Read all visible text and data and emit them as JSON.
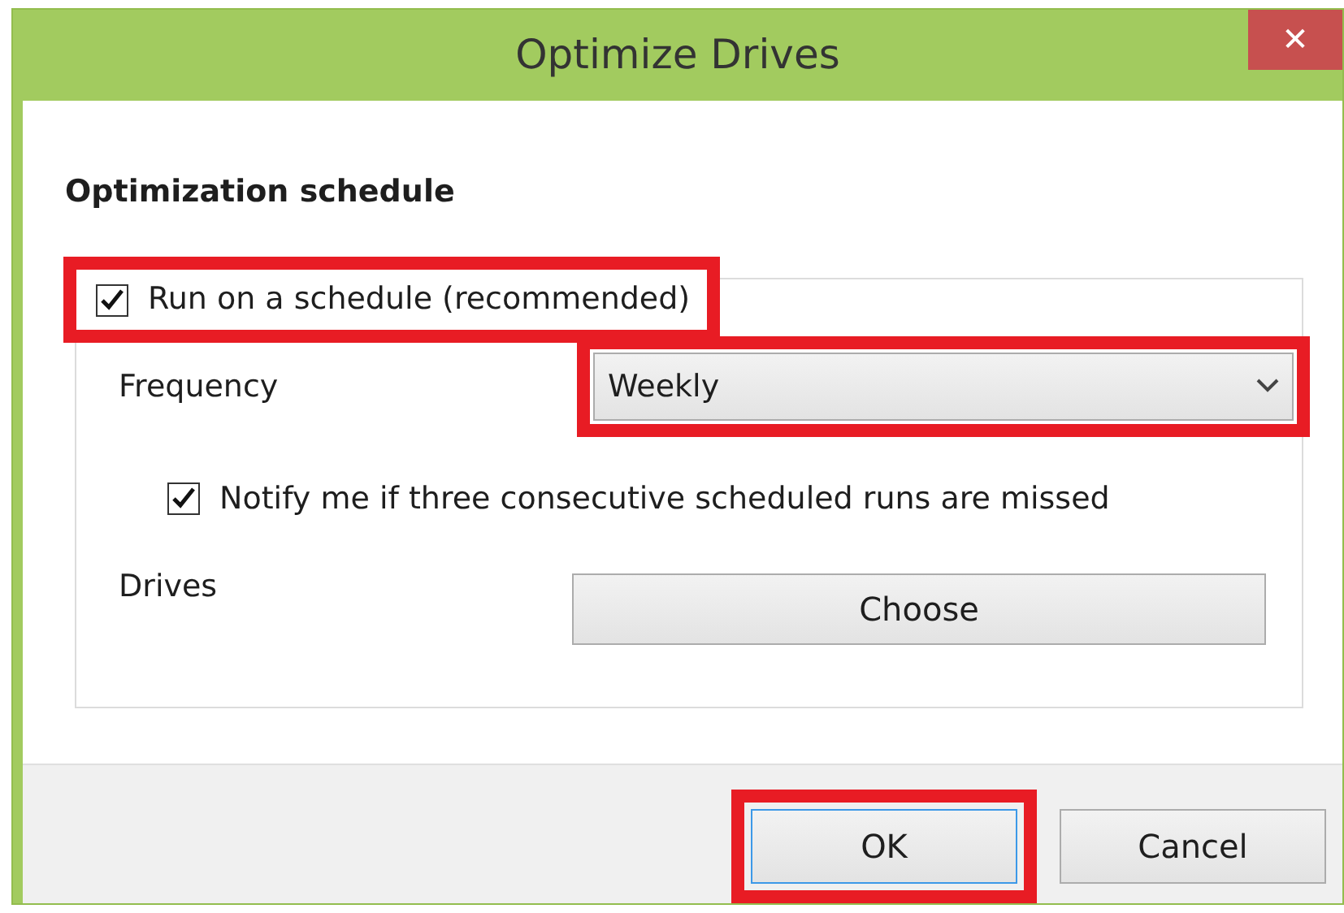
{
  "window": {
    "title": "Optimize Drives",
    "close": "✕"
  },
  "section_title": "Optimization schedule",
  "schedule": {
    "label": "Run on a schedule (recommended)",
    "checked": true,
    "highlighted": true
  },
  "frequency": {
    "label": "Frequency",
    "value": "Weekly",
    "highlighted": true
  },
  "notify": {
    "label": "Notify me if three consecutive scheduled runs are missed",
    "checked": true
  },
  "drives": {
    "label": "Drives",
    "button": "Choose"
  },
  "buttons": [
    {
      "label": "OK",
      "default": true,
      "highlighted": true
    },
    {
      "label": "Cancel",
      "default": false,
      "highlighted": false
    }
  ]
}
